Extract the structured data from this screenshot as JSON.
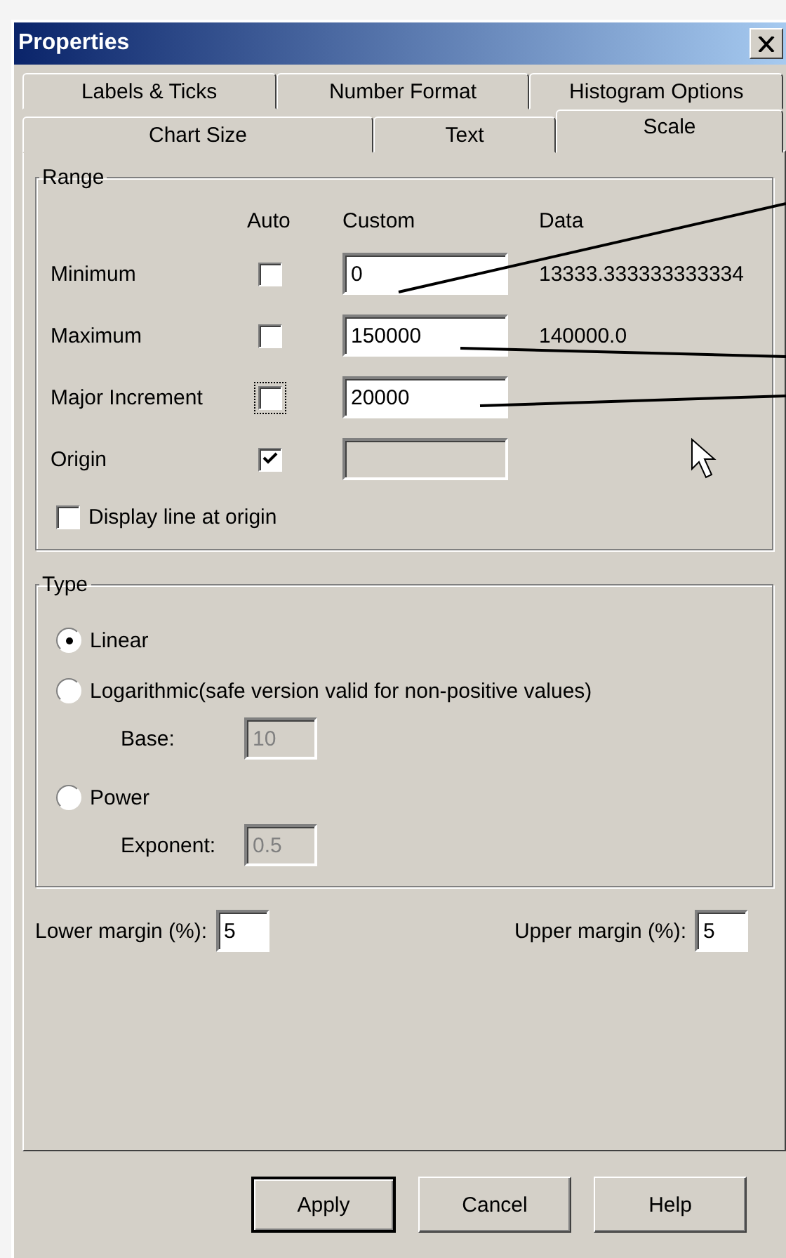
{
  "window": {
    "title": "Properties"
  },
  "tab_rows": [
    {
      "tabs": [
        {
          "label": "Labels & Ticks",
          "selected": false
        },
        {
          "label": "Number Format",
          "selected": false
        },
        {
          "label": "Histogram Options",
          "selected": false
        }
      ]
    },
    {
      "tabs": [
        {
          "label": "Chart Size",
          "selected": false
        },
        {
          "label": "Text",
          "selected": false
        },
        {
          "label": "Scale",
          "selected": true
        }
      ]
    }
  ],
  "range": {
    "title": "Range",
    "headers": [
      "Auto",
      "Custom",
      "Data"
    ],
    "rows": [
      {
        "label": "Minimum",
        "auto_checked": false,
        "focused": false,
        "custom": "0",
        "custom_disabled": false,
        "data": "13333.333333333334"
      },
      {
        "label": "Maximum",
        "auto_checked": false,
        "focused": false,
        "custom": "150000",
        "custom_disabled": false,
        "data": "140000.0"
      },
      {
        "label": "Major Increment",
        "auto_checked": false,
        "focused": true,
        "custom": "20000",
        "custom_disabled": false
      },
      {
        "label": "Origin",
        "auto_checked": true,
        "focused": false,
        "custom_disabled": true
      }
    ],
    "origin_line": {
      "label": "Display line at origin",
      "checked": false
    }
  },
  "type": {
    "title": "Type",
    "options": [
      {
        "label": "Linear",
        "selected": true
      },
      {
        "label": "Logarithmic(safe version valid for non-positive values)",
        "selected": false,
        "param": {
          "label": "Base:",
          "value": "10",
          "disabled": true
        }
      },
      {
        "label": "Power",
        "selected": false,
        "param": {
          "label": "Exponent:",
          "value": "0.5",
          "disabled": true
        }
      }
    ]
  },
  "margins": [
    {
      "label": "Lower margin (%):",
      "value": "5"
    },
    {
      "label": "Upper margin (%):",
      "value": "5"
    }
  ],
  "buttons": [
    {
      "label": "Apply",
      "default": true
    },
    {
      "label": "Cancel",
      "default": false
    },
    {
      "label": "Help",
      "default": false
    }
  ]
}
